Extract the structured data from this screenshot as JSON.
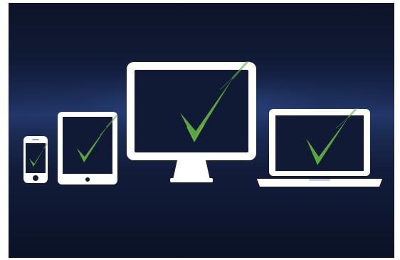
{
  "scene": {
    "colors": {
      "background_top": "#0d1328",
      "background_band": "#22376a",
      "background_bottom": "#0b1226",
      "device_frame": "#ffffff",
      "screen": "#0f1730",
      "checkmark": "#5aa63c",
      "checkmark_highlight": "#7fc85a"
    },
    "devices": [
      {
        "name": "smartphone",
        "icon": "smartphone-icon",
        "status": "checkmark-icon"
      },
      {
        "name": "tablet",
        "icon": "tablet-icon",
        "status": "checkmark-icon"
      },
      {
        "name": "desktop-monitor",
        "icon": "monitor-icon",
        "status": "checkmark-icon"
      },
      {
        "name": "laptop",
        "icon": "laptop-icon",
        "status": "checkmark-icon"
      }
    ]
  }
}
